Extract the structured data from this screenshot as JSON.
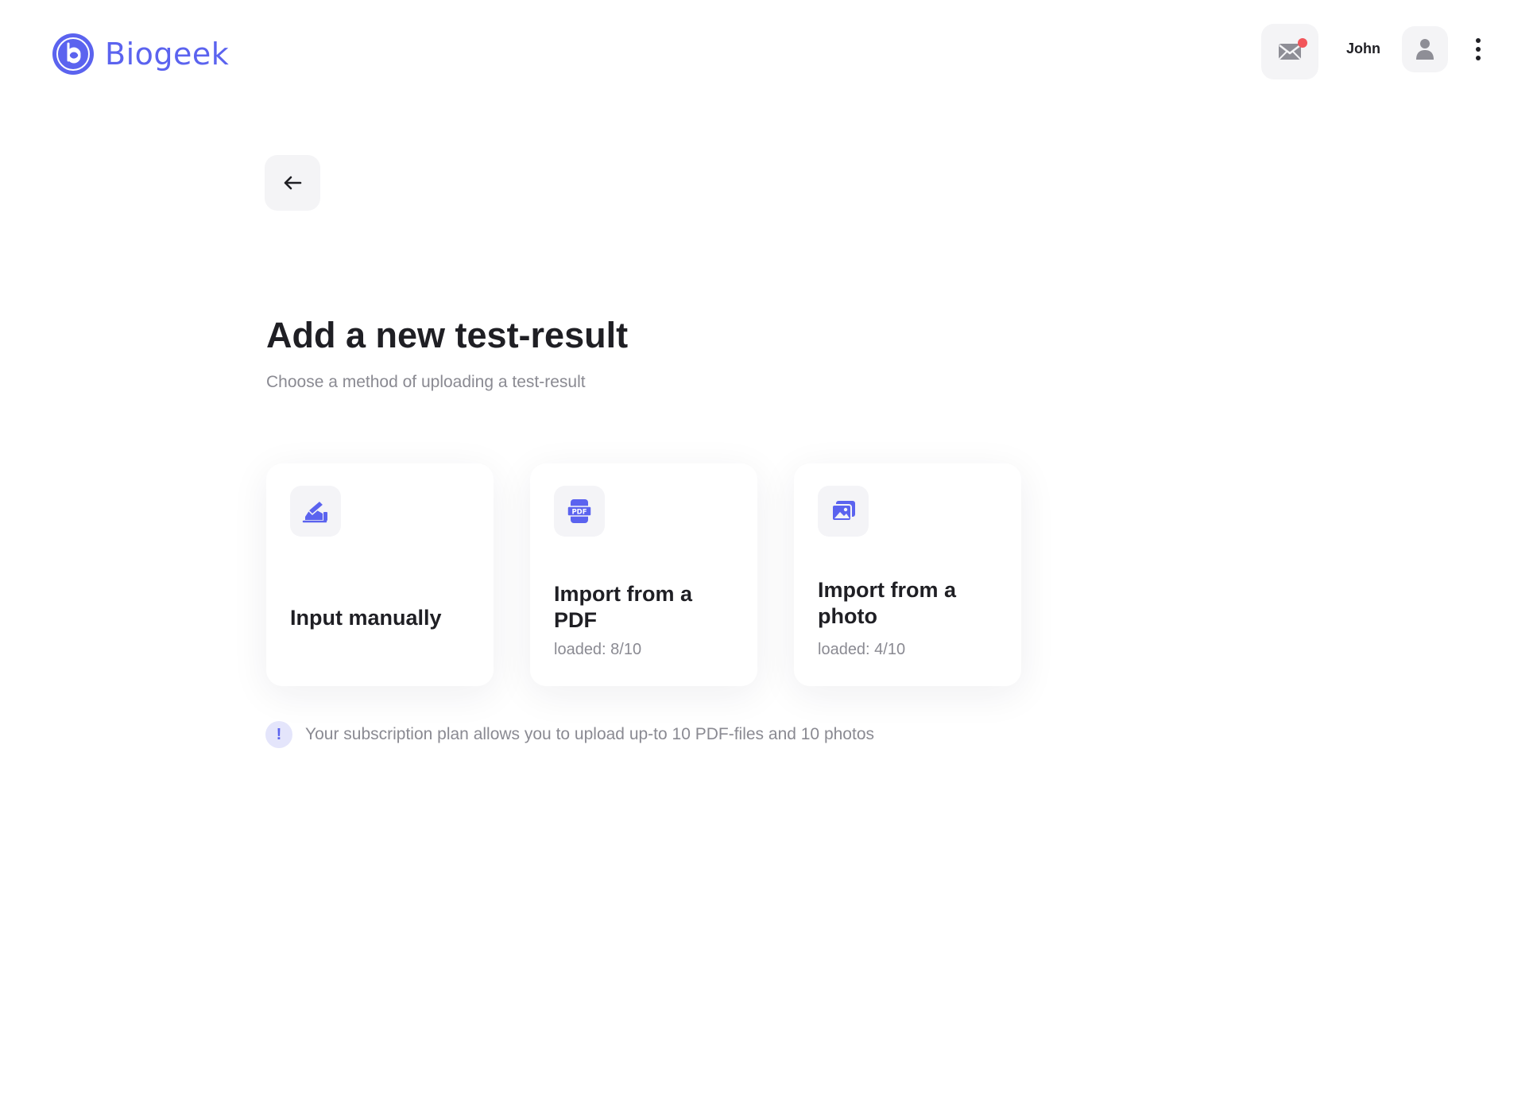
{
  "header": {
    "logo_text": "Biogeek",
    "logo_icon": "biogeek-logo-icon",
    "mail_icon": "mail-icon",
    "has_unread": true,
    "user_name": "John",
    "avatar_icon": "user-icon",
    "more_icon": "more-vertical-icon"
  },
  "back_icon": "arrow-left-icon",
  "title": "Add a new test-result",
  "subtitle": "Choose a method of uploading a test-result",
  "cards": [
    {
      "icon": "hand-writing-icon",
      "title": "Input manually",
      "sub": ""
    },
    {
      "icon": "pdf-file-icon",
      "title": "Import from a PDF",
      "sub": "loaded: 8/10"
    },
    {
      "icon": "photo-gallery-icon",
      "title": "Import from a photo",
      "sub": "loaded: 4/10"
    }
  ],
  "note": {
    "icon": "exclamation-icon",
    "mark": "!",
    "text": "Your subscription plan allows you to upload up-to 10 PDF-files and 10 photos"
  },
  "colors": {
    "accent": "#5b63ef",
    "notification_dot": "#f2555a",
    "muted_text": "#8a8a92",
    "button_bg": "#f4f4f6"
  }
}
